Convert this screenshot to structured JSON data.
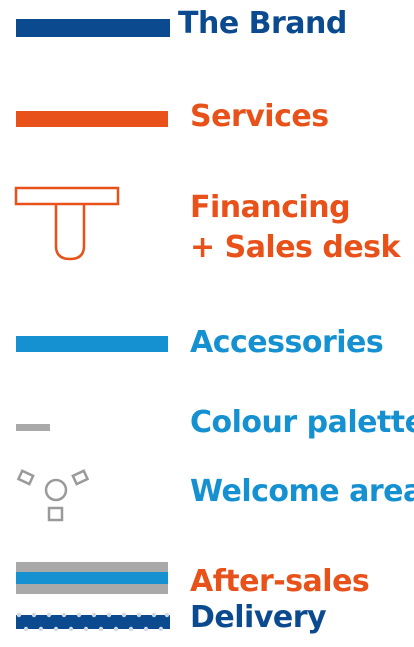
{
  "legend": {
    "items": [
      {
        "label": "The Brand",
        "symbol": "dark-blue-bar",
        "color": "#0b4a8f"
      },
      {
        "label": "Services",
        "symbol": "orange-bar",
        "color": "#e8521a"
      },
      {
        "label_line1": "Financing",
        "label_line2": "+ Sales desk",
        "symbol": "sales-desk-outline-icon",
        "color": "#e8521a"
      },
      {
        "label": "Accessories",
        "symbol": "light-blue-bar",
        "color": "#1591d2"
      },
      {
        "label": "Colour palette",
        "symbol": "grey-dash",
        "color": "#1591d2"
      },
      {
        "label": "Welcome area",
        "symbol": "seating-cluster-icon",
        "color": "#1591d2"
      },
      {
        "label": "After-sales",
        "symbol": "grey-blue-band",
        "color": "#e8521a"
      },
      {
        "label": "Delivery",
        "symbol": "dotted-navy-bar",
        "color": "#0b4a8f"
      }
    ]
  }
}
